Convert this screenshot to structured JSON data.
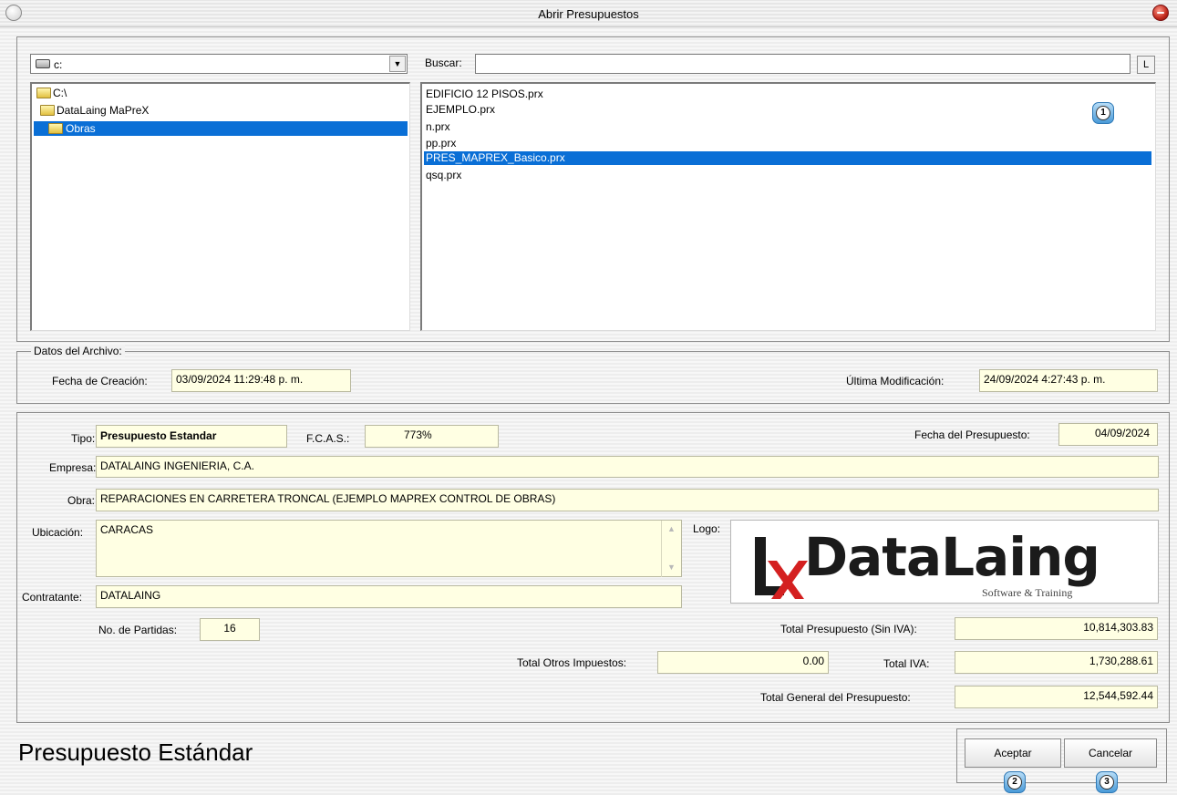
{
  "window": {
    "title": "Abrir Presupuestos"
  },
  "drive": {
    "value": "c:"
  },
  "tree": {
    "items": [
      {
        "label": "C:\\",
        "selected": false
      },
      {
        "label": "DataLaing MaPreX",
        "selected": false
      },
      {
        "label": "Obras",
        "selected": true
      }
    ]
  },
  "search": {
    "label": "Buscar:",
    "value": "",
    "button": "L"
  },
  "files": [
    {
      "name": "EDIFICIO 12 PISOS.prx",
      "selected": false
    },
    {
      "name": "EJEMPLO.prx",
      "selected": false
    },
    {
      "name": "n.prx",
      "selected": false
    },
    {
      "name": "pp.prx",
      "selected": false
    },
    {
      "name": "PRES_MAPREX_Basico.prx",
      "selected": true
    },
    {
      "name": "qsq.prx",
      "selected": false
    }
  ],
  "badges": {
    "b1": "1",
    "b2": "2",
    "b3": "3"
  },
  "file_info": {
    "legend": "Datos del Archivo:",
    "created_label": "Fecha de Creación:",
    "created_value": "03/09/2024 11:29:48 p. m.",
    "modified_label": "Última Modificación:",
    "modified_value": "24/09/2024 4:27:43 p. m."
  },
  "budget": {
    "tipo_label": "Tipo:",
    "tipo_value": "Presupuesto Estandar",
    "fcas_label": "F.C.A.S.:",
    "fcas_value": "773%",
    "fecha_label": "Fecha del Presupuesto:",
    "fecha_value": "04/09/2024",
    "empresa_label": "Empresa:",
    "empresa_value": "DATALAING INGENIERIA, C.A.",
    "obra_label": "Obra:",
    "obra_value": "REPARACIONES EN CARRETERA TRONCAL (EJEMPLO MAPREX CONTROL DE OBRAS)",
    "ubicacion_label": "Ubicación:",
    "ubicacion_value": "CARACAS",
    "logo_label": "Logo:",
    "contratante_label": "Contratante:",
    "contratante_value": "DATALAING",
    "partidas_label": "No. de Partidas:",
    "partidas_value": "16",
    "total_sin_iva_label": "Total Presupuesto (Sin IVA):",
    "total_sin_iva_value": "10,814,303.83",
    "otros_label": "Total Otros Impuestos:",
    "otros_value": "0.00",
    "iva_label": "Total IVA:",
    "iva_value": "1,730,288.61",
    "general_label": "Total General del Presupuesto:",
    "general_value": "12,544,592.44"
  },
  "logo": {
    "brand": "DataLaing",
    "tagline": "Software & Training"
  },
  "status": {
    "title": "Presupuesto Estándar"
  },
  "buttons": {
    "accept": "Aceptar",
    "cancel": "Cancelar"
  },
  "colors": {
    "selection": "#0a6fd6",
    "field_bg": "#ffffe3",
    "logo_red": "#d42020"
  }
}
